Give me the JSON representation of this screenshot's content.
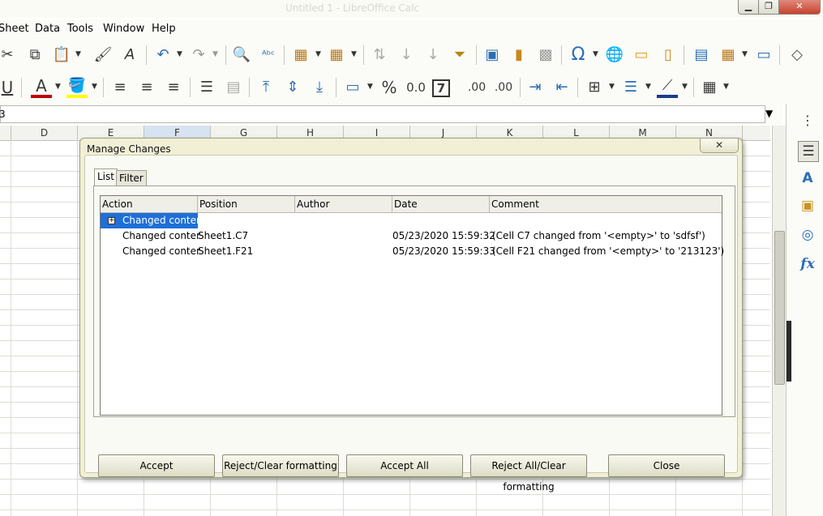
{
  "window": {
    "title_faint": "Untitled 1 - LibreOffice Calc",
    "controls": {
      "minimize": "▁",
      "maximize": "❐",
      "close": "✕"
    }
  },
  "menubar": {
    "items": [
      "Sheet",
      "Data",
      "Tools",
      "Window",
      "Help"
    ]
  },
  "toolbar1": {
    "icons": [
      "cut-icon",
      "copy-icon",
      "paste-icon",
      "clone-formatting-icon",
      "clear-formatting-icon",
      "undo-icon",
      "redo-icon",
      "find-replace-icon",
      "spelling-icon",
      "row-icon",
      "column-icon",
      "sort-icon",
      "sort-ascending-icon",
      "sort-descending-icon",
      "autofilter-icon",
      "image-icon",
      "chart-icon",
      "pivot-table-icon",
      "special-character-icon",
      "hyperlink-icon",
      "comment-icon",
      "header-footer-icon",
      "define-print-area-icon",
      "freeze-rows-icon",
      "split-window-icon",
      "show-draw-functions-icon"
    ],
    "glyphs": {
      "cut": "✂",
      "copy": "⧉",
      "paste": "📋",
      "brush": "🖌",
      "clear": "A",
      "undo": "↶",
      "redo": "↷",
      "find": "🔍",
      "spell": "ᴬᵇᶜ",
      "omega": "Ω",
      "globe": "🌐",
      "comment": "💬"
    }
  },
  "toolbar2": {
    "underline": "U",
    "font_color": "A",
    "percent": "%",
    "decimal": "0.0",
    "seven": "7",
    "add_decimal": ".00",
    "del_decimal": ".00"
  },
  "formula_bar": {
    "name_box_fragment": "3",
    "dropdown": "▼"
  },
  "grid": {
    "columns": [
      "D",
      "E",
      "F",
      "G",
      "H",
      "I",
      "J",
      "K",
      "L",
      "M",
      "N"
    ],
    "selected_column": "F"
  },
  "sidebar": {
    "menu_glyph": "⋮",
    "icons": [
      "properties-icon",
      "styles-icon",
      "gallery-icon",
      "navigator-icon",
      "functions-icon"
    ],
    "fx": "fx"
  },
  "dialog": {
    "title": "Manage Changes",
    "close_glyph": "✕",
    "tabs": [
      "List",
      "Filter"
    ],
    "columns": [
      "Action",
      "Position",
      "Author",
      "Date",
      "Comment"
    ],
    "rows": [
      {
        "expander": "+",
        "action": "Changed conter",
        "position": "",
        "author": "",
        "date": "",
        "comment": "",
        "selected": true
      },
      {
        "action": "Changed conter",
        "position": "Sheet1.C7",
        "author": "",
        "date": "05/23/2020 15:59:32",
        "comment": "(Cell C7 changed from '<empty>' to 'sdfsf')"
      },
      {
        "action": "Changed conter",
        "position": "Sheet1.F21",
        "author": "",
        "date": "05/23/2020 15:59:33",
        "comment": "(Cell F21 changed from '<empty>' to '213123')"
      }
    ],
    "buttons": {
      "accept": "Accept",
      "reject": "Reject/Clear formatting",
      "accept_all": "Accept All",
      "reject_all": "Reject All/Clear formatting",
      "close": "Close"
    }
  }
}
